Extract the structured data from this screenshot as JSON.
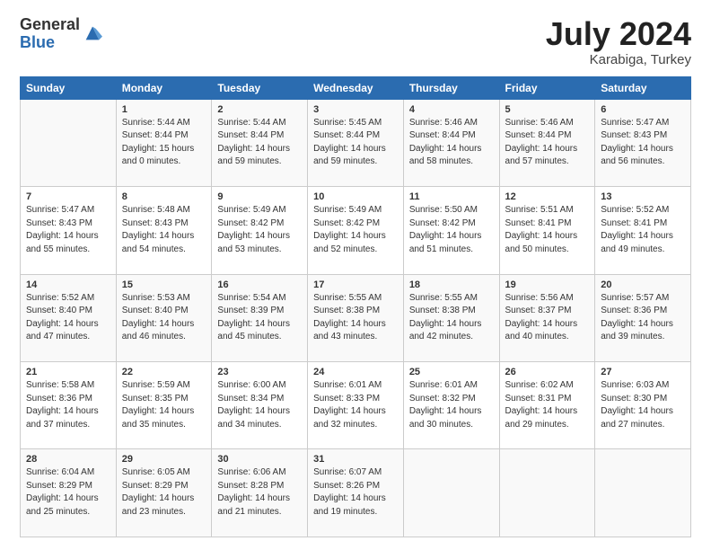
{
  "header": {
    "logo_general": "General",
    "logo_blue": "Blue",
    "month_title": "July 2024",
    "location": "Karabiga, Turkey"
  },
  "weekdays": [
    "Sunday",
    "Monday",
    "Tuesday",
    "Wednesday",
    "Thursday",
    "Friday",
    "Saturday"
  ],
  "weeks": [
    [
      {
        "day": "",
        "sunrise": "",
        "sunset": "",
        "daylight": ""
      },
      {
        "day": "1",
        "sunrise": "Sunrise: 5:44 AM",
        "sunset": "Sunset: 8:44 PM",
        "daylight": "Daylight: 15 hours and 0 minutes."
      },
      {
        "day": "2",
        "sunrise": "Sunrise: 5:44 AM",
        "sunset": "Sunset: 8:44 PM",
        "daylight": "Daylight: 14 hours and 59 minutes."
      },
      {
        "day": "3",
        "sunrise": "Sunrise: 5:45 AM",
        "sunset": "Sunset: 8:44 PM",
        "daylight": "Daylight: 14 hours and 59 minutes."
      },
      {
        "day": "4",
        "sunrise": "Sunrise: 5:46 AM",
        "sunset": "Sunset: 8:44 PM",
        "daylight": "Daylight: 14 hours and 58 minutes."
      },
      {
        "day": "5",
        "sunrise": "Sunrise: 5:46 AM",
        "sunset": "Sunset: 8:44 PM",
        "daylight": "Daylight: 14 hours and 57 minutes."
      },
      {
        "day": "6",
        "sunrise": "Sunrise: 5:47 AM",
        "sunset": "Sunset: 8:43 PM",
        "daylight": "Daylight: 14 hours and 56 minutes."
      }
    ],
    [
      {
        "day": "7",
        "sunrise": "Sunrise: 5:47 AM",
        "sunset": "Sunset: 8:43 PM",
        "daylight": "Daylight: 14 hours and 55 minutes."
      },
      {
        "day": "8",
        "sunrise": "Sunrise: 5:48 AM",
        "sunset": "Sunset: 8:43 PM",
        "daylight": "Daylight: 14 hours and 54 minutes."
      },
      {
        "day": "9",
        "sunrise": "Sunrise: 5:49 AM",
        "sunset": "Sunset: 8:42 PM",
        "daylight": "Daylight: 14 hours and 53 minutes."
      },
      {
        "day": "10",
        "sunrise": "Sunrise: 5:49 AM",
        "sunset": "Sunset: 8:42 PM",
        "daylight": "Daylight: 14 hours and 52 minutes."
      },
      {
        "day": "11",
        "sunrise": "Sunrise: 5:50 AM",
        "sunset": "Sunset: 8:42 PM",
        "daylight": "Daylight: 14 hours and 51 minutes."
      },
      {
        "day": "12",
        "sunrise": "Sunrise: 5:51 AM",
        "sunset": "Sunset: 8:41 PM",
        "daylight": "Daylight: 14 hours and 50 minutes."
      },
      {
        "day": "13",
        "sunrise": "Sunrise: 5:52 AM",
        "sunset": "Sunset: 8:41 PM",
        "daylight": "Daylight: 14 hours and 49 minutes."
      }
    ],
    [
      {
        "day": "14",
        "sunrise": "Sunrise: 5:52 AM",
        "sunset": "Sunset: 8:40 PM",
        "daylight": "Daylight: 14 hours and 47 minutes."
      },
      {
        "day": "15",
        "sunrise": "Sunrise: 5:53 AM",
        "sunset": "Sunset: 8:40 PM",
        "daylight": "Daylight: 14 hours and 46 minutes."
      },
      {
        "day": "16",
        "sunrise": "Sunrise: 5:54 AM",
        "sunset": "Sunset: 8:39 PM",
        "daylight": "Daylight: 14 hours and 45 minutes."
      },
      {
        "day": "17",
        "sunrise": "Sunrise: 5:55 AM",
        "sunset": "Sunset: 8:38 PM",
        "daylight": "Daylight: 14 hours and 43 minutes."
      },
      {
        "day": "18",
        "sunrise": "Sunrise: 5:55 AM",
        "sunset": "Sunset: 8:38 PM",
        "daylight": "Daylight: 14 hours and 42 minutes."
      },
      {
        "day": "19",
        "sunrise": "Sunrise: 5:56 AM",
        "sunset": "Sunset: 8:37 PM",
        "daylight": "Daylight: 14 hours and 40 minutes."
      },
      {
        "day": "20",
        "sunrise": "Sunrise: 5:57 AM",
        "sunset": "Sunset: 8:36 PM",
        "daylight": "Daylight: 14 hours and 39 minutes."
      }
    ],
    [
      {
        "day": "21",
        "sunrise": "Sunrise: 5:58 AM",
        "sunset": "Sunset: 8:36 PM",
        "daylight": "Daylight: 14 hours and 37 minutes."
      },
      {
        "day": "22",
        "sunrise": "Sunrise: 5:59 AM",
        "sunset": "Sunset: 8:35 PM",
        "daylight": "Daylight: 14 hours and 35 minutes."
      },
      {
        "day": "23",
        "sunrise": "Sunrise: 6:00 AM",
        "sunset": "Sunset: 8:34 PM",
        "daylight": "Daylight: 14 hours and 34 minutes."
      },
      {
        "day": "24",
        "sunrise": "Sunrise: 6:01 AM",
        "sunset": "Sunset: 8:33 PM",
        "daylight": "Daylight: 14 hours and 32 minutes."
      },
      {
        "day": "25",
        "sunrise": "Sunrise: 6:01 AM",
        "sunset": "Sunset: 8:32 PM",
        "daylight": "Daylight: 14 hours and 30 minutes."
      },
      {
        "day": "26",
        "sunrise": "Sunrise: 6:02 AM",
        "sunset": "Sunset: 8:31 PM",
        "daylight": "Daylight: 14 hours and 29 minutes."
      },
      {
        "day": "27",
        "sunrise": "Sunrise: 6:03 AM",
        "sunset": "Sunset: 8:30 PM",
        "daylight": "Daylight: 14 hours and 27 minutes."
      }
    ],
    [
      {
        "day": "28",
        "sunrise": "Sunrise: 6:04 AM",
        "sunset": "Sunset: 8:29 PM",
        "daylight": "Daylight: 14 hours and 25 minutes."
      },
      {
        "day": "29",
        "sunrise": "Sunrise: 6:05 AM",
        "sunset": "Sunset: 8:29 PM",
        "daylight": "Daylight: 14 hours and 23 minutes."
      },
      {
        "day": "30",
        "sunrise": "Sunrise: 6:06 AM",
        "sunset": "Sunset: 8:28 PM",
        "daylight": "Daylight: 14 hours and 21 minutes."
      },
      {
        "day": "31",
        "sunrise": "Sunrise: 6:07 AM",
        "sunset": "Sunset: 8:26 PM",
        "daylight": "Daylight: 14 hours and 19 minutes."
      },
      {
        "day": "",
        "sunrise": "",
        "sunset": "",
        "daylight": ""
      },
      {
        "day": "",
        "sunrise": "",
        "sunset": "",
        "daylight": ""
      },
      {
        "day": "",
        "sunrise": "",
        "sunset": "",
        "daylight": ""
      }
    ]
  ]
}
